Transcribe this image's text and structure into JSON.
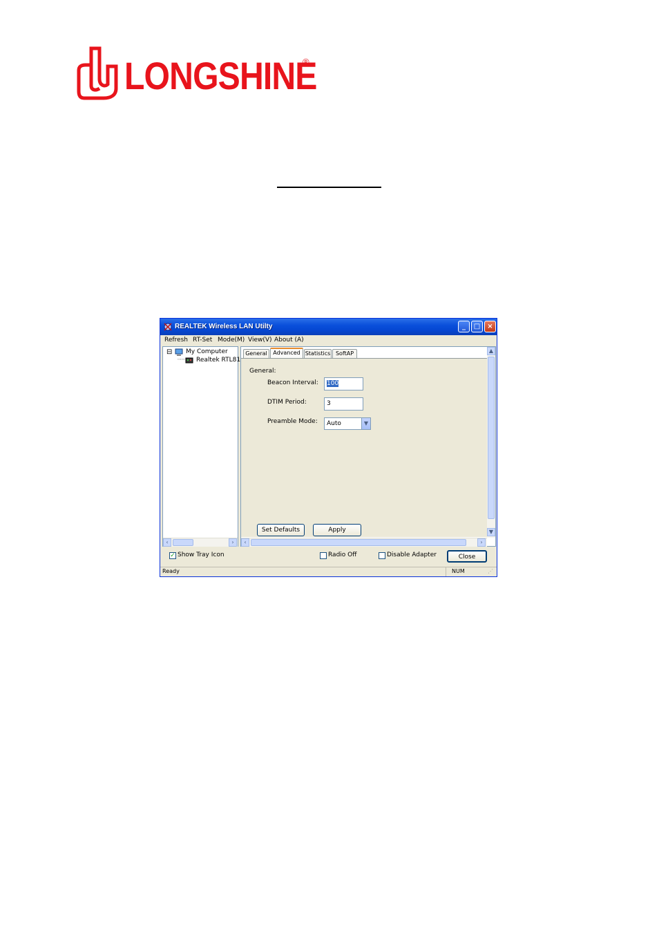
{
  "logo": {
    "brand": "LONGSHINE",
    "registered": "®"
  },
  "window": {
    "title": "REALTEK Wireless LAN Utilty",
    "controls": {
      "minimize": "_",
      "maximize": "□",
      "close": "×"
    }
  },
  "menu": [
    "Refresh",
    "RT-Set",
    "Mode(M)",
    "View(V)",
    "About (A)"
  ],
  "tree": {
    "expander": "⊟",
    "root": "My Computer",
    "child": "Realtek RTL81"
  },
  "tabs": [
    "General",
    "Advanced",
    "Statistics",
    "SoftAP"
  ],
  "active_tab": "Advanced",
  "advanced": {
    "section": "General:",
    "beacon_label": "Beacon Interval:",
    "beacon_value": "100",
    "dtim_label": "DTIM Period:",
    "dtim_value": "3",
    "preamble_label": "Preamble Mode:",
    "preamble_value": "Auto"
  },
  "buttons": {
    "set_defaults": "Set Defaults",
    "apply": "Apply",
    "close": "Close"
  },
  "footer": {
    "show_tray": "Show Tray Icon",
    "show_tray_checked": true,
    "radio_off": "Radio Off",
    "disable_adapter": "Disable Adapter"
  },
  "status": {
    "text": "Ready",
    "num": "NUM"
  },
  "colors": {
    "brand_red": "#e8141c",
    "title_blue": "#0a4fdb",
    "selection": "#316ac5"
  }
}
